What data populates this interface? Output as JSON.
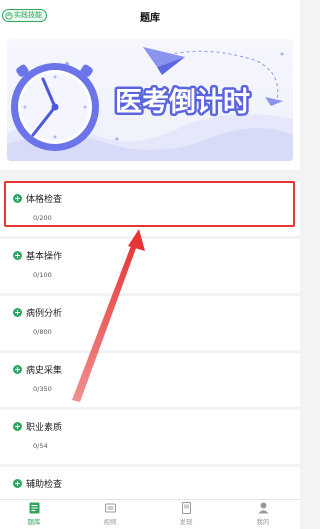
{
  "header": {
    "mode_badge": "实践技能",
    "title": "题库"
  },
  "banner": {
    "text": "医考倒计时",
    "icons": [
      "clock-icon",
      "paper-plane-icon"
    ]
  },
  "categories": [
    {
      "name": "体格检查",
      "progress": "0/200",
      "highlighted": true
    },
    {
      "name": "基本操作",
      "progress": "0/100"
    },
    {
      "name": "病例分析",
      "progress": "0/800"
    },
    {
      "name": "病史采集",
      "progress": "0/350"
    },
    {
      "name": "职业素质",
      "progress": "0/54"
    },
    {
      "name": "辅助检查",
      "progress": ""
    }
  ],
  "tabbar": [
    {
      "label": "题库",
      "icon": "question-bank-icon",
      "active": true
    },
    {
      "label": "视频",
      "icon": "video-icon"
    },
    {
      "label": "发现",
      "icon": "discover-icon"
    },
    {
      "label": "我的",
      "icon": "profile-icon"
    }
  ],
  "colors": {
    "accent": "#2fa55e",
    "highlight": "#e63535",
    "banner_purple": "#6b74e8"
  }
}
